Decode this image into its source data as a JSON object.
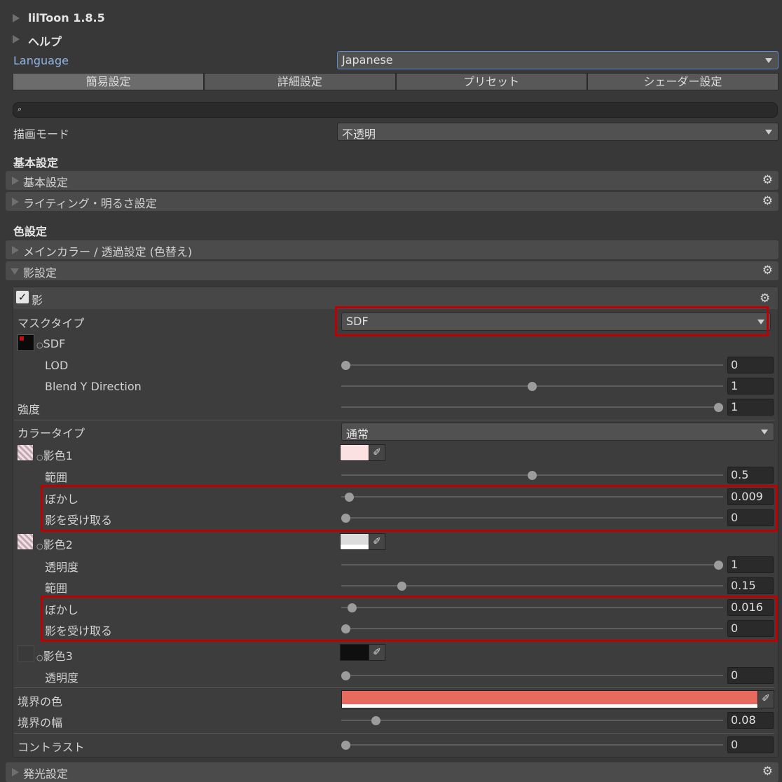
{
  "header": {
    "title": "lilToon 1.8.5",
    "help": "ヘルプ"
  },
  "language": {
    "label": "Language",
    "value": "Japanese"
  },
  "tabs": [
    "簡易設定",
    "詳細設定",
    "プリセット",
    "シェーダー設定"
  ],
  "render_mode": {
    "label": "描画モード",
    "value": "不透明"
  },
  "section_basic": {
    "title": "基本設定",
    "items": [
      "基本設定",
      "ライティング・明るさ設定"
    ]
  },
  "section_color": {
    "title": "色設定",
    "main_color": "メインカラー / 透過設定 (色替え)",
    "shadow": "影設定"
  },
  "shadow": {
    "toggle_label": "影",
    "mask_type_label": "マスクタイプ",
    "mask_type_value": "SDF",
    "sdf_label": "SDF",
    "lod": {
      "label": "LOD",
      "value": "0",
      "fraction": 0
    },
    "blend_y": {
      "label": "Blend Y Direction",
      "value": "1",
      "fraction": 0.5
    },
    "strength": {
      "label": "強度",
      "value": "1",
      "fraction": 1
    },
    "color_type_label": "カラータイプ",
    "color_type_value": "通常",
    "shade1": {
      "label": "影色1",
      "color": "#fbe1e1",
      "range": {
        "label": "範囲",
        "value": "0.5",
        "fraction": 0.5
      },
      "blur": {
        "label": "ぼかし",
        "value": "0.009",
        "fraction": 0.009
      },
      "receive": {
        "label": "影を受け取る",
        "value": "0",
        "fraction": 0
      }
    },
    "shade2": {
      "label": "影色2",
      "color": "#dcdcdc",
      "alpha": {
        "label": "透明度",
        "value": "1",
        "fraction": 1
      },
      "range": {
        "label": "範囲",
        "value": "0.15",
        "fraction": 0.15
      },
      "blur": {
        "label": "ぼかし",
        "value": "0.016",
        "fraction": 0.016
      },
      "receive": {
        "label": "影を受け取る",
        "value": "0",
        "fraction": 0
      }
    },
    "shade3": {
      "label": "影色3",
      "color": "#0f0f0f",
      "alpha": {
        "label": "透明度",
        "value": "0",
        "fraction": 0
      }
    },
    "border_color": {
      "label": "境界の色",
      "color": "#e8695e"
    },
    "border_width": {
      "label": "境界の幅",
      "value": "0.08",
      "fraction": 0.08
    },
    "contrast": {
      "label": "コントラスト",
      "value": "0",
      "fraction": 0
    }
  },
  "emission": {
    "title": "発光設定"
  },
  "colors": {
    "highlight_box": "#c00000",
    "link": "#8fb4e6"
  }
}
